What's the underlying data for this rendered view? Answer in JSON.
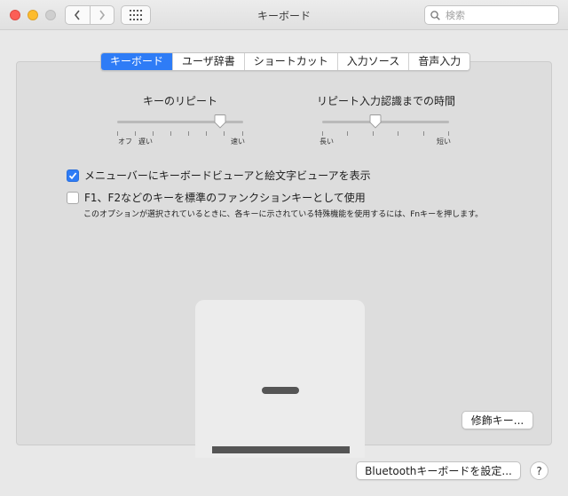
{
  "window": {
    "title": "キーボード"
  },
  "search": {
    "placeholder": "検索"
  },
  "tabs": [
    {
      "label": "キーボード",
      "active": true
    },
    {
      "label": "ユーザ辞書",
      "active": false
    },
    {
      "label": "ショートカット",
      "active": false
    },
    {
      "label": "入力ソース",
      "active": false
    },
    {
      "label": "音声入力",
      "active": false
    }
  ],
  "key_repeat": {
    "title": "キーのリピート",
    "labels": [
      "オフ",
      "遅い",
      "速い"
    ],
    "level": 0.82
  },
  "repeat_delay": {
    "title": "リピート入力認識までの時間",
    "labels": [
      "長い",
      "短い"
    ],
    "level": 0.42
  },
  "options": {
    "show_viewer": {
      "label": "メニューバーにキーボードビューアと絵文字ビューアを表示",
      "checked": true
    },
    "fn_keys": {
      "label": "F1、F2などのキーを標準のファンクションキーとして使用",
      "checked": false
    },
    "fn_note": "このオプションが選択されているときに、各キーに示されている特殊機能を使用するには、Fnキーを押します。"
  },
  "buttons": {
    "modifier": "修飾キー...",
    "bluetooth": "Bluetoothキーボードを設定...",
    "help": "?"
  },
  "colors": {
    "accent": "#2e7cf6",
    "close": "#fc5f57",
    "minimize": "#fdbc2e"
  }
}
